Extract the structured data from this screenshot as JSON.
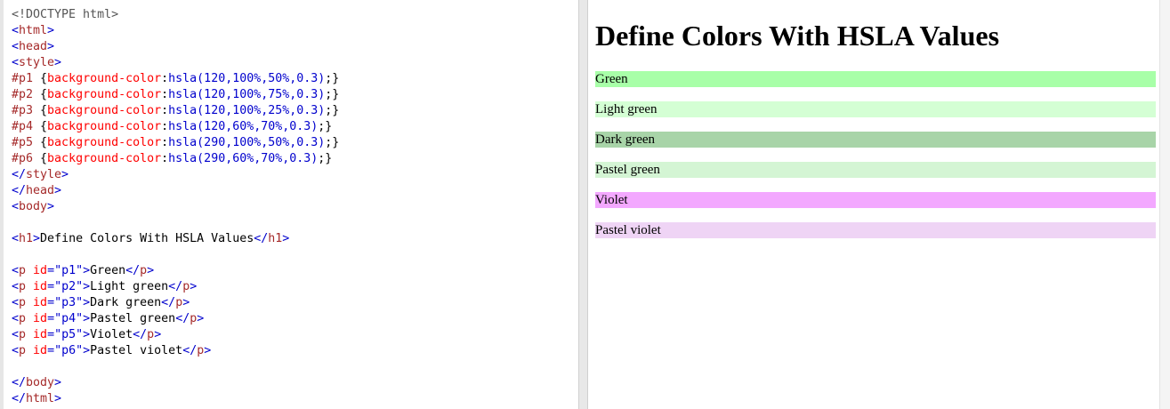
{
  "editor": {
    "lines": [
      [
        {
          "c": "doctype",
          "t": "<!DOCTYPE html>"
        }
      ],
      [
        {
          "c": "bracket",
          "t": "<"
        },
        {
          "c": "tag",
          "t": "html"
        },
        {
          "c": "bracket",
          "t": ">"
        }
      ],
      [
        {
          "c": "bracket",
          "t": "<"
        },
        {
          "c": "tag",
          "t": "head"
        },
        {
          "c": "bracket",
          "t": ">"
        }
      ],
      [
        {
          "c": "bracket",
          "t": "<"
        },
        {
          "c": "tag",
          "t": "style"
        },
        {
          "c": "bracket",
          "t": ">"
        }
      ],
      [
        {
          "c": "selector",
          "t": "#p1 "
        },
        {
          "c": "text",
          "t": "{"
        },
        {
          "c": "prop",
          "t": "background-color"
        },
        {
          "c": "text",
          "t": ":"
        },
        {
          "c": "value",
          "t": "hsla(120,100%,50%,0.3)"
        },
        {
          "c": "text",
          "t": ";}"
        }
      ],
      [
        {
          "c": "selector",
          "t": "#p2 "
        },
        {
          "c": "text",
          "t": "{"
        },
        {
          "c": "prop",
          "t": "background-color"
        },
        {
          "c": "text",
          "t": ":"
        },
        {
          "c": "value",
          "t": "hsla(120,100%,75%,0.3)"
        },
        {
          "c": "text",
          "t": ";}"
        }
      ],
      [
        {
          "c": "selector",
          "t": "#p3 "
        },
        {
          "c": "text",
          "t": "{"
        },
        {
          "c": "prop",
          "t": "background-color"
        },
        {
          "c": "text",
          "t": ":"
        },
        {
          "c": "value",
          "t": "hsla(120,100%,25%,0.3)"
        },
        {
          "c": "text",
          "t": ";}"
        }
      ],
      [
        {
          "c": "selector",
          "t": "#p4 "
        },
        {
          "c": "text",
          "t": "{"
        },
        {
          "c": "prop",
          "t": "background-color"
        },
        {
          "c": "text",
          "t": ":"
        },
        {
          "c": "value",
          "t": "hsla(120,60%,70%,0.3)"
        },
        {
          "c": "text",
          "t": ";}"
        }
      ],
      [
        {
          "c": "selector",
          "t": "#p5 "
        },
        {
          "c": "text",
          "t": "{"
        },
        {
          "c": "prop",
          "t": "background-color"
        },
        {
          "c": "text",
          "t": ":"
        },
        {
          "c": "value",
          "t": "hsla(290,100%,50%,0.3)"
        },
        {
          "c": "text",
          "t": ";}"
        }
      ],
      [
        {
          "c": "selector",
          "t": "#p6 "
        },
        {
          "c": "text",
          "t": "{"
        },
        {
          "c": "prop",
          "t": "background-color"
        },
        {
          "c": "text",
          "t": ":"
        },
        {
          "c": "value",
          "t": "hsla(290,60%,70%,0.3)"
        },
        {
          "c": "text",
          "t": ";}"
        }
      ],
      [
        {
          "c": "bracket",
          "t": "</"
        },
        {
          "c": "tag",
          "t": "style"
        },
        {
          "c": "bracket",
          "t": ">"
        }
      ],
      [
        {
          "c": "bracket",
          "t": "</"
        },
        {
          "c": "tag",
          "t": "head"
        },
        {
          "c": "bracket",
          "t": ">"
        }
      ],
      [
        {
          "c": "bracket",
          "t": "<"
        },
        {
          "c": "tag",
          "t": "body"
        },
        {
          "c": "bracket",
          "t": ">"
        }
      ],
      [],
      [
        {
          "c": "bracket",
          "t": "<"
        },
        {
          "c": "tag",
          "t": "h1"
        },
        {
          "c": "bracket",
          "t": ">"
        },
        {
          "c": "text",
          "t": "Define Colors With HSLA Values"
        },
        {
          "c": "bracket",
          "t": "</"
        },
        {
          "c": "tag",
          "t": "h1"
        },
        {
          "c": "bracket",
          "t": ">"
        }
      ],
      [],
      [
        {
          "c": "bracket",
          "t": "<"
        },
        {
          "c": "tag",
          "t": "p"
        },
        {
          "c": "text",
          "t": " "
        },
        {
          "c": "attr",
          "t": "id"
        },
        {
          "c": "attrval",
          "t": "=\"p1\""
        },
        {
          "c": "bracket",
          "t": ">"
        },
        {
          "c": "text",
          "t": "Green"
        },
        {
          "c": "bracket",
          "t": "</"
        },
        {
          "c": "tag",
          "t": "p"
        },
        {
          "c": "bracket",
          "t": ">"
        }
      ],
      [
        {
          "c": "bracket",
          "t": "<"
        },
        {
          "c": "tag",
          "t": "p"
        },
        {
          "c": "text",
          "t": " "
        },
        {
          "c": "attr",
          "t": "id"
        },
        {
          "c": "attrval",
          "t": "=\"p2\""
        },
        {
          "c": "bracket",
          "t": ">"
        },
        {
          "c": "text",
          "t": "Light green"
        },
        {
          "c": "bracket",
          "t": "</"
        },
        {
          "c": "tag",
          "t": "p"
        },
        {
          "c": "bracket",
          "t": ">"
        }
      ],
      [
        {
          "c": "bracket",
          "t": "<"
        },
        {
          "c": "tag",
          "t": "p"
        },
        {
          "c": "text",
          "t": " "
        },
        {
          "c": "attr",
          "t": "id"
        },
        {
          "c": "attrval",
          "t": "=\"p3\""
        },
        {
          "c": "bracket",
          "t": ">"
        },
        {
          "c": "text",
          "t": "Dark green"
        },
        {
          "c": "bracket",
          "t": "</"
        },
        {
          "c": "tag",
          "t": "p"
        },
        {
          "c": "bracket",
          "t": ">"
        }
      ],
      [
        {
          "c": "bracket",
          "t": "<"
        },
        {
          "c": "tag",
          "t": "p"
        },
        {
          "c": "text",
          "t": " "
        },
        {
          "c": "attr",
          "t": "id"
        },
        {
          "c": "attrval",
          "t": "=\"p4\""
        },
        {
          "c": "bracket",
          "t": ">"
        },
        {
          "c": "text",
          "t": "Pastel green"
        },
        {
          "c": "bracket",
          "t": "</"
        },
        {
          "c": "tag",
          "t": "p"
        },
        {
          "c": "bracket",
          "t": ">"
        }
      ],
      [
        {
          "c": "bracket",
          "t": "<"
        },
        {
          "c": "tag",
          "t": "p"
        },
        {
          "c": "text",
          "t": " "
        },
        {
          "c": "attr",
          "t": "id"
        },
        {
          "c": "attrval",
          "t": "=\"p5\""
        },
        {
          "c": "bracket",
          "t": ">"
        },
        {
          "c": "text",
          "t": "Violet"
        },
        {
          "c": "bracket",
          "t": "</"
        },
        {
          "c": "tag",
          "t": "p"
        },
        {
          "c": "bracket",
          "t": ">"
        }
      ],
      [
        {
          "c": "bracket",
          "t": "<"
        },
        {
          "c": "tag",
          "t": "p"
        },
        {
          "c": "text",
          "t": " "
        },
        {
          "c": "attr",
          "t": "id"
        },
        {
          "c": "attrval",
          "t": "=\"p6\""
        },
        {
          "c": "bracket",
          "t": ">"
        },
        {
          "c": "text",
          "t": "Pastel violet"
        },
        {
          "c": "bracket",
          "t": "</"
        },
        {
          "c": "tag",
          "t": "p"
        },
        {
          "c": "bracket",
          "t": ">"
        }
      ],
      [],
      [
        {
          "c": "bracket",
          "t": "</"
        },
        {
          "c": "tag",
          "t": "body"
        },
        {
          "c": "bracket",
          "t": ">"
        }
      ],
      [
        {
          "c": "bracket",
          "t": "</"
        },
        {
          "c": "tag",
          "t": "html"
        },
        {
          "c": "bracket",
          "t": ">"
        }
      ]
    ]
  },
  "result": {
    "heading": "Define Colors With HSLA Values",
    "paragraphs": [
      {
        "text": "Green",
        "color": "#a8ffa8"
      },
      {
        "text": "Light green",
        "color": "#d4ffd4"
      },
      {
        "text": "Dark green",
        "color": "#a8d4a8"
      },
      {
        "text": "Pastel green",
        "color": "#d4f5d4"
      },
      {
        "text": "Violet",
        "color": "#f3a8ff"
      },
      {
        "text": "Pastel violet",
        "color": "#efd4f5"
      }
    ]
  }
}
